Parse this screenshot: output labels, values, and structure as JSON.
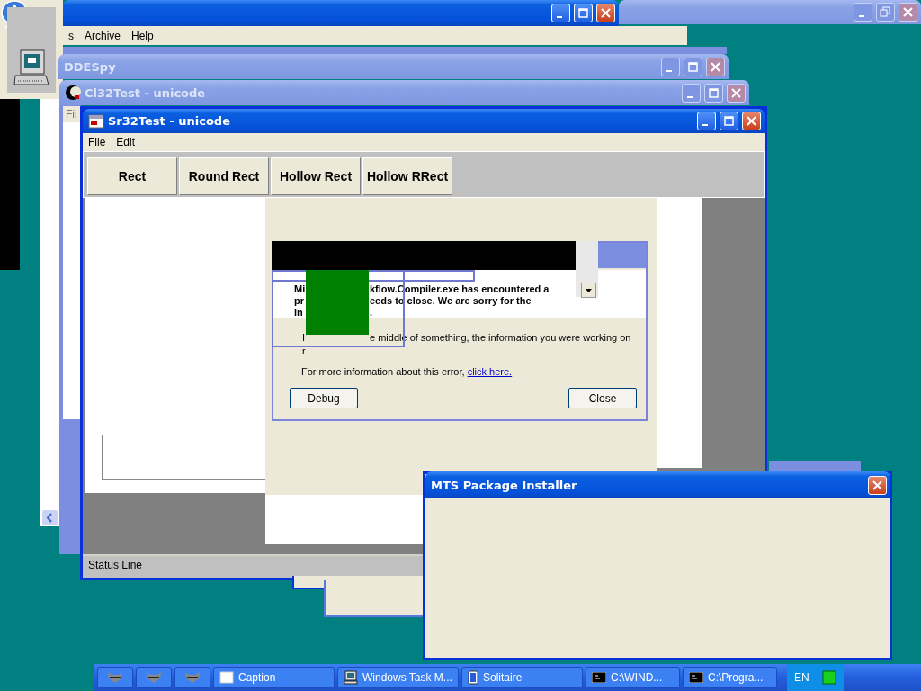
{
  "windows": [
    {
      "active": false
    },
    {
      "active": true,
      "menu": [
        "s",
        "Archive",
        "Help"
      ]
    },
    {
      "title": "DDESpy",
      "active": false
    },
    {
      "title": "Cl32Test - unicode",
      "active": false,
      "menu": [
        "Fil"
      ]
    },
    {
      "title": "Sr32Test - unicode",
      "active": true,
      "menu": [
        "File",
        "Edit"
      ],
      "toolbar": [
        "Rect",
        "Round Rect",
        "Hollow Rect",
        "Hollow RRect"
      ],
      "status": "Status Line"
    },
    {
      "title": "MTS Package Installer",
      "active": true
    }
  ],
  "error_dialog": {
    "header": [
      [
        "Mi",
        "kflow.Compiler.exe has encountered a"
      ],
      [
        "pr",
        "eeds to close.  We are sorry for the"
      ],
      [
        "in",
        "."
      ]
    ],
    "body": [
      [
        "I",
        "e middle of something, the information you were working on"
      ],
      [
        "r"
      ]
    ],
    "more_info": "For more information about this error,",
    "link": "click here.",
    "buttons": [
      "Debug",
      "Close"
    ]
  },
  "taskbar": {
    "items": [
      {
        "kind": "raccoon"
      },
      {
        "kind": "raccoon"
      },
      {
        "kind": "raccoon"
      },
      {
        "kind": "window",
        "label": "Caption"
      },
      {
        "kind": "monitor",
        "label": "Windows Task M..."
      },
      {
        "kind": "card",
        "label": "Solitaire"
      },
      {
        "kind": "console",
        "label": "C:\\WIND..."
      },
      {
        "kind": "console",
        "label": "C:\\Progra..."
      }
    ],
    "language": "EN"
  }
}
